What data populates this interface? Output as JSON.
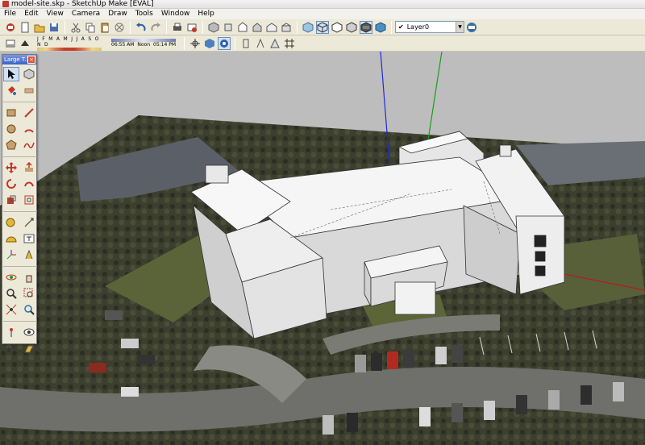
{
  "window": {
    "title": "model-site.skp - SketchUp Make [EVAL]"
  },
  "menu": [
    "File",
    "Edit",
    "View",
    "Camera",
    "Draw",
    "Tools",
    "Window",
    "Help"
  ],
  "toolbar": {
    "layer_value": "Layer0",
    "layer_check": "✔",
    "shadow_months": "J F M A M J J A S O N D",
    "shadow_time_start": "06:55 AM",
    "shadow_time_mid": "Noon",
    "shadow_time_end": "05:14 PM"
  },
  "palette": {
    "title": "Large T...",
    "close_label": "×"
  },
  "colors": {
    "toolbar": "#ece9d8",
    "accent": "#3b63c6",
    "axis_blue": "#1d2bd6",
    "axis_green": "#19a019",
    "axis_red": "#b71c1c"
  }
}
